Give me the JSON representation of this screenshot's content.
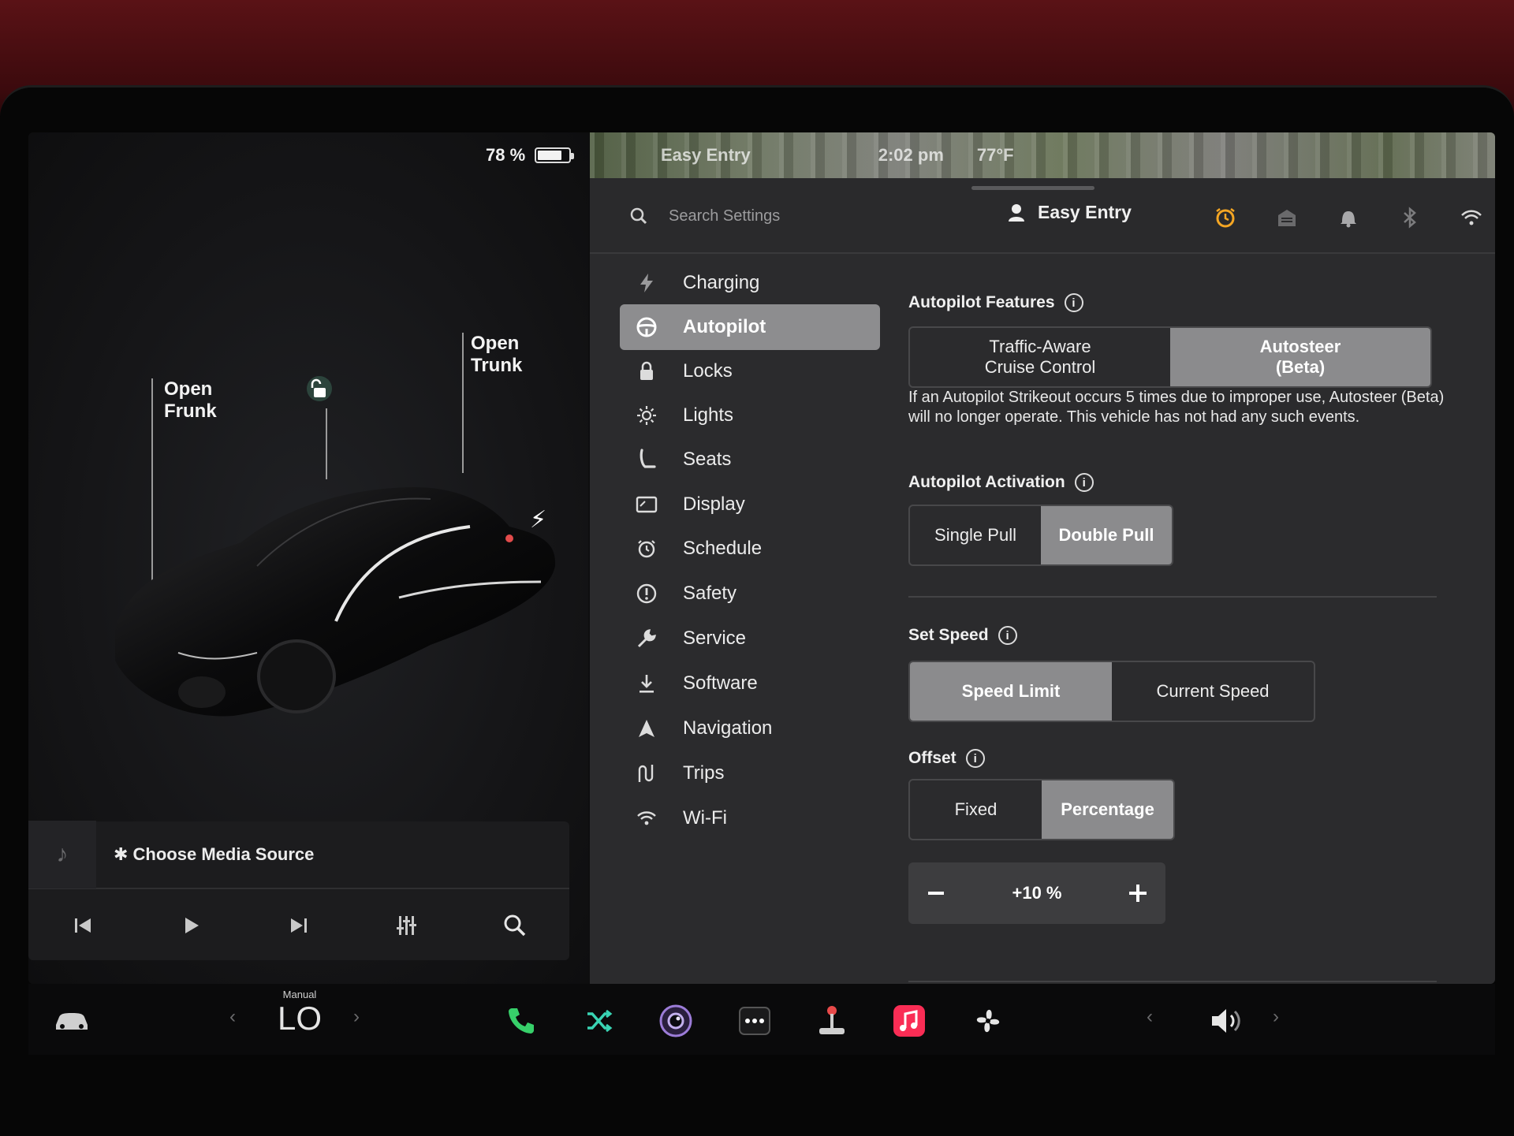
{
  "status": {
    "battery_percent_label": "78 %",
    "battery_level": 0.78,
    "profile": "Easy Entry",
    "time": "2:02 pm",
    "temperature": "77°F"
  },
  "car_view": {
    "open_frunk_line1": "Open",
    "open_frunk_line2": "Frunk",
    "open_trunk_line1": "Open",
    "open_trunk_line2": "Trunk"
  },
  "media": {
    "source_label": "Choose Media Source",
    "controls": [
      "previous-track",
      "play",
      "next-track",
      "equalizer",
      "search"
    ]
  },
  "topbar": {
    "search_placeholder": "Search Settings",
    "profile_name": "Easy Entry",
    "icons": [
      "alarm-clock-icon",
      "garage-icon",
      "bell-icon",
      "bluetooth-icon",
      "wifi-icon"
    ]
  },
  "menu": {
    "items": [
      {
        "label": "Charging",
        "icon": "bolt-icon"
      },
      {
        "label": "Autopilot",
        "icon": "steering-wheel-icon",
        "active": true
      },
      {
        "label": "Locks",
        "icon": "lock-icon"
      },
      {
        "label": "Lights",
        "icon": "sun-icon"
      },
      {
        "label": "Seats",
        "icon": "seat-icon"
      },
      {
        "label": "Display",
        "icon": "display-icon"
      },
      {
        "label": "Schedule",
        "icon": "schedule-icon"
      },
      {
        "label": "Safety",
        "icon": "alert-circle-icon"
      },
      {
        "label": "Service",
        "icon": "wrench-icon"
      },
      {
        "label": "Software",
        "icon": "download-icon"
      },
      {
        "label": "Navigation",
        "icon": "navigation-arrow-icon"
      },
      {
        "label": "Trips",
        "icon": "trips-icon"
      },
      {
        "label": "Wi-Fi",
        "icon": "wifi-icon"
      }
    ]
  },
  "autopilot": {
    "features_title": "Autopilot Features",
    "features_options": [
      {
        "line1": "Traffic-Aware",
        "line2": "Cruise Control",
        "selected": false
      },
      {
        "line1": "Autosteer",
        "line2": "(Beta)",
        "selected": true
      }
    ],
    "strikeout_description": "If an Autopilot Strikeout occurs 5 times due to improper use, Autosteer (Beta) will no longer operate. This vehicle has not had any such events.",
    "activation_title": "Autopilot Activation",
    "activation_options": [
      {
        "label": "Single Pull",
        "selected": false
      },
      {
        "label": "Double Pull",
        "selected": true
      }
    ],
    "set_speed_title": "Set Speed",
    "set_speed_options": [
      {
        "label": "Speed Limit",
        "selected": true
      },
      {
        "label": "Current Speed",
        "selected": false
      }
    ],
    "offset_title": "Offset",
    "offset_options": [
      {
        "label": "Fixed",
        "selected": false
      },
      {
        "label": "Percentage",
        "selected": true
      }
    ],
    "offset_value": "+10 %"
  },
  "dock": {
    "climate_mode": "Manual",
    "climate_temp": "LO",
    "apps": [
      "car-icon",
      "phone-icon",
      "shuffle-icon",
      "camera-icon",
      "more-icon",
      "joystick-icon",
      "music-icon",
      "fan-icon",
      "volume-icon"
    ]
  },
  "colors": {
    "accent_orange": "#f5a623",
    "selected_gray": "#8b8b8d",
    "phone_green": "#37d06a",
    "music_red": "#fa2d55"
  }
}
